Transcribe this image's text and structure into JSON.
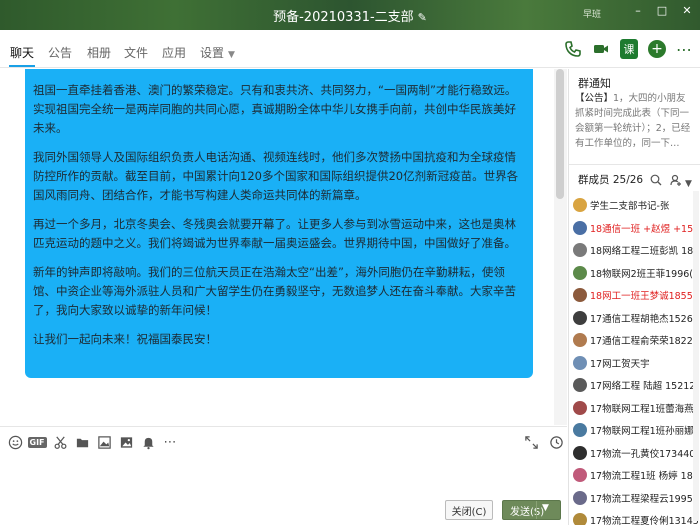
{
  "window": {
    "title": "预备-20210331-二支部",
    "user_label": "早班",
    "controls": [
      "–",
      "□",
      "✕"
    ]
  },
  "tabs": [
    {
      "label": "聊天",
      "active": true
    },
    {
      "label": "公告",
      "active": false
    },
    {
      "label": "相册",
      "active": false
    },
    {
      "label": "文件",
      "active": false
    },
    {
      "label": "应用",
      "active": false
    },
    {
      "label": "设置",
      "active": false
    }
  ],
  "toolbar_icons": [
    "phone-icon",
    "video-icon",
    "class-icon",
    "add-icon",
    "more-icon"
  ],
  "toolbar": {
    "class_label": "课",
    "plus_label": "+",
    "more_label": "⋯"
  },
  "message": {
    "paragraphs": [
      "祖国一直牵挂着香港、澳门的繁荣稳定。只有和衷共济、共同努力，“一国两制”才能行稳致远。实现祖国完全统一是两岸同胞的共同心愿，真诚期盼全体中华儿女携手向前，共创中华民族美好未来。",
      "我同外国领导人及国际组织负责人电话沟通、视频连线时，他们多次赞扬中国抗疫和为全球疫情防控所作的贡献。截至目前，中国累计向120多个国家和国际组织提供20亿剂新冠疫苗。世界各国风雨同舟、团结合作，才能书写构建人类命运共同体的新篇章。",
      "再过一个多月，北京冬奥会、冬残奥会就要开幕了。让更多人参与到冰雪运动中来，这也是奥林匹克运动的题中之义。我们将竭诚为世界奉献一届奥运盛会。世界期待中国，中国做好了准备。",
      "新年的钟声即将敲响。我们的三位航天员正在浩瀚太空“出差”，海外同胞仍在辛勤耕耘，使领馆、中资企业等海外派驻人员和广大留学生仍在勇毅坚守，无数追梦人还在奋斗奉献。大家辛苦了，我向大家致以诚挚的新年问候！",
      "让我们一起向未来！祝福国泰民安！"
    ]
  },
  "input_toolbar": {
    "icons": [
      "emoji-icon",
      "gif-icon",
      "scissors-icon",
      "folder-icon",
      "image-icon",
      "picture-icon",
      "bell-icon",
      "more-dots-icon"
    ],
    "right_icons": [
      "expand-icon",
      "history-icon"
    ],
    "gif_label": "GIF"
  },
  "buttons": {
    "close": "关闭(C)",
    "send": "发送(S)"
  },
  "notice": {
    "title": "群通知",
    "tag": "【公告】",
    "text": "1，大四的小朋友抓紧时间完成此表（下同一会额第一轮统计）；2，已经有工作单位的，同一下…"
  },
  "members": {
    "title": "群成员 25/26",
    "list": [
      {
        "name": "学生二支部书记-张",
        "red": false,
        "color": "#d9a441"
      },
      {
        "name": "18通信一班 +赵煜 +1581",
        "red": true,
        "color": "#4a6fa5"
      },
      {
        "name": "18网络工程二班彭凯 18",
        "red": false,
        "color": "#7a7a7a"
      },
      {
        "name": "18物联网2班王菲1996(",
        "red": false,
        "color": "#5c8a4a"
      },
      {
        "name": "18网工一班王梦诚18551",
        "red": true,
        "color": "#8c5a3c"
      },
      {
        "name": "17通信工程胡艳杰15265(",
        "red": false,
        "color": "#3e3e3e"
      },
      {
        "name": "17通信工程俞荣荣18226",
        "red": false,
        "color": "#b07b4f"
      },
      {
        "name": "17网工贺天宇",
        "red": false,
        "color": "#6f8fb5"
      },
      {
        "name": "17网络工程 陆超 152120",
        "red": false,
        "color": "#5a5a5a"
      },
      {
        "name": "17物联网工程1班蕾海燕15",
        "red": false,
        "color": "#a04a4a"
      },
      {
        "name": "17物联网工程1班孙丽娜18",
        "red": false,
        "color": "#4a7aa0"
      },
      {
        "name": "17物流一孔黄佼173440",
        "red": false,
        "color": "#2e2e2e"
      },
      {
        "name": "17物流工程1班 杨婷 185",
        "red": false,
        "color": "#c05a7a"
      },
      {
        "name": "17物流工程梁程云19956",
        "red": false,
        "color": "#6a6a8a"
      },
      {
        "name": "17物流工程夏伶俐13145",
        "red": false,
        "color": "#b08a3a"
      }
    ]
  },
  "colors": {
    "bubble": "#1ab0f6",
    "accent": "#1aa0e6",
    "titlebar": "#3a6a32",
    "send": "#6e8a5a"
  }
}
